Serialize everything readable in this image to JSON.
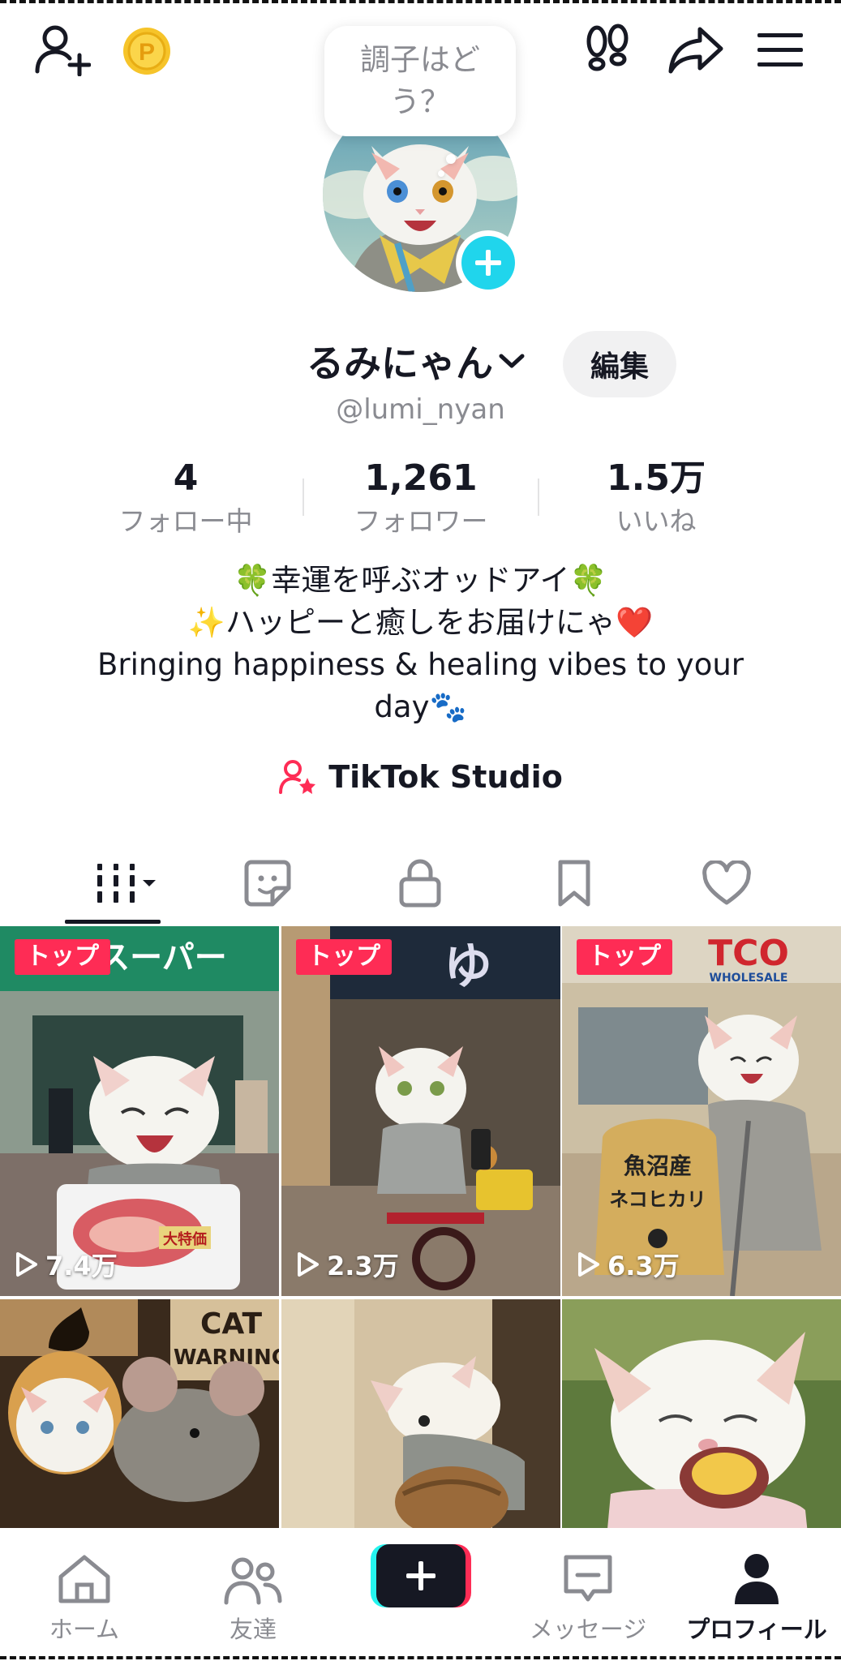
{
  "header": {
    "add_friend_icon": "person-plus-icon",
    "coin_icon": "p-coin-icon",
    "coin_letter": "P",
    "footprint_icon": "footprints-icon",
    "share_icon": "share-arrow-icon",
    "menu_icon": "hamburger-menu-icon"
  },
  "profile": {
    "bubble_line1": "調子はど",
    "bubble_line2": "う？",
    "display_name": "るみにゃん",
    "edit_label": "編集",
    "handle": "@lumi_nyan"
  },
  "stats": [
    {
      "value": "4",
      "label": "フォロー中"
    },
    {
      "value": "1,261",
      "label": "フォロワー"
    },
    {
      "value": "1.5万",
      "label": "いいね"
    }
  ],
  "bio": {
    "line1": "🍀幸運を呼ぶオッドアイ🍀",
    "line2": "✨ハッピーと癒しをお届けにゃ❤️",
    "line3": "Bringing happiness & healing vibes to your",
    "line4": "day🐾"
  },
  "studio": {
    "label": "TikTok Studio"
  },
  "tabs": [
    {
      "icon": "videos-grid-icon"
    },
    {
      "icon": "sticker-icon"
    },
    {
      "icon": "lock-icon"
    },
    {
      "icon": "bookmark-icon"
    },
    {
      "icon": "heart-icon"
    }
  ],
  "videos": [
    {
      "badge": "トップ",
      "views": "7.4万"
    },
    {
      "badge": "トップ",
      "views": "2.3万"
    },
    {
      "badge": "トップ",
      "views": "6.3万"
    },
    {
      "badge": "",
      "views": ""
    },
    {
      "badge": "",
      "views": ""
    },
    {
      "badge": "",
      "views": ""
    }
  ],
  "video_signs": {
    "cat_warning_line1": "CAT",
    "cat_warning_line2": "WARNING",
    "bag_line1": "魚沼産",
    "bag_line2": "ネコヒカリ",
    "meat_label": "大特価",
    "store1": "スーパー",
    "store2": "ゆ",
    "store3": "TCO",
    "store3_sub": "WHOLESALE"
  },
  "bottom_nav": [
    {
      "label": "ホーム",
      "icon": "home-icon"
    },
    {
      "label": "友達",
      "icon": "friends-icon"
    },
    {
      "label": "",
      "icon": "plus-icon"
    },
    {
      "label": "メッセージ",
      "icon": "message-icon"
    },
    {
      "label": "プロフィール",
      "icon": "profile-icon"
    }
  ],
  "colors": {
    "accent_red": "#fe2c55",
    "accent_cyan": "#25f4ee",
    "add_button": "#20d5ec",
    "studio_icon": "#fe2c55"
  }
}
